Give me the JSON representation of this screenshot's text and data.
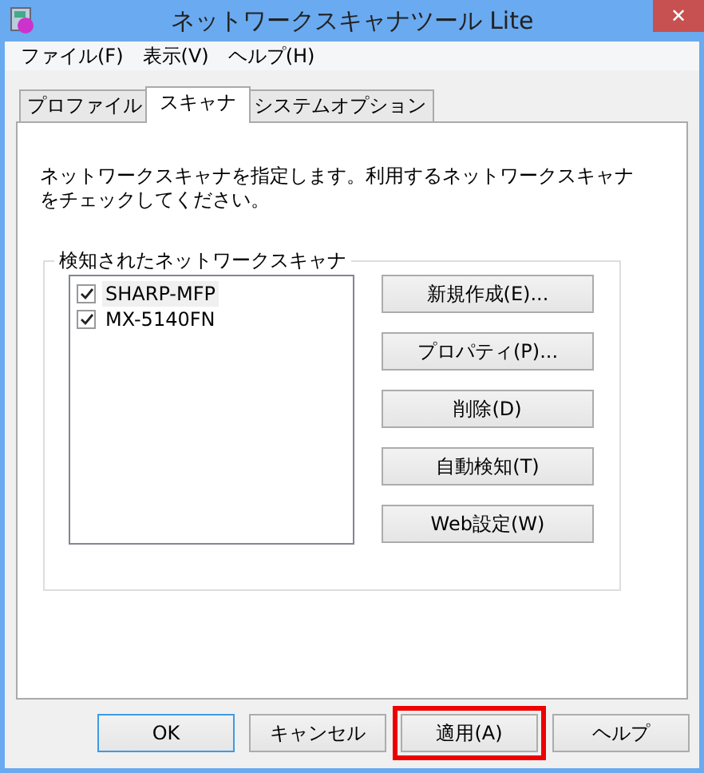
{
  "window": {
    "title": "ネットワークスキャナツール Lite",
    "close": "✕"
  },
  "menu": [
    "ファイル(F)",
    "表示(V)",
    "ヘルプ(H)"
  ],
  "tabs": [
    {
      "label": "プロファイル",
      "selected": false
    },
    {
      "label": "スキャナ",
      "selected": true
    },
    {
      "label": "システムオプション",
      "selected": false
    }
  ],
  "description": "ネットワークスキャナを指定します。利用するネットワークスキャナをチェックしてください。",
  "group": {
    "title": "検知されたネットワークスキャナ",
    "scanners": [
      {
        "name": "SHARP-MFP",
        "checked": true,
        "selected": true
      },
      {
        "name": "MX-5140FN",
        "checked": true,
        "selected": false
      }
    ],
    "buttons": [
      "新規作成(E)...",
      "プロパティ(P)...",
      "削除(D)",
      "自動検知(T)",
      "Web設定(W)"
    ]
  },
  "footer_buttons": [
    {
      "label": "OK",
      "default": true,
      "highlighted": false
    },
    {
      "label": "キャンセル",
      "default": false,
      "highlighted": false
    },
    {
      "label": "適用(A)",
      "default": false,
      "highlighted": true
    },
    {
      "label": "ヘルプ",
      "default": false,
      "highlighted": false
    }
  ]
}
